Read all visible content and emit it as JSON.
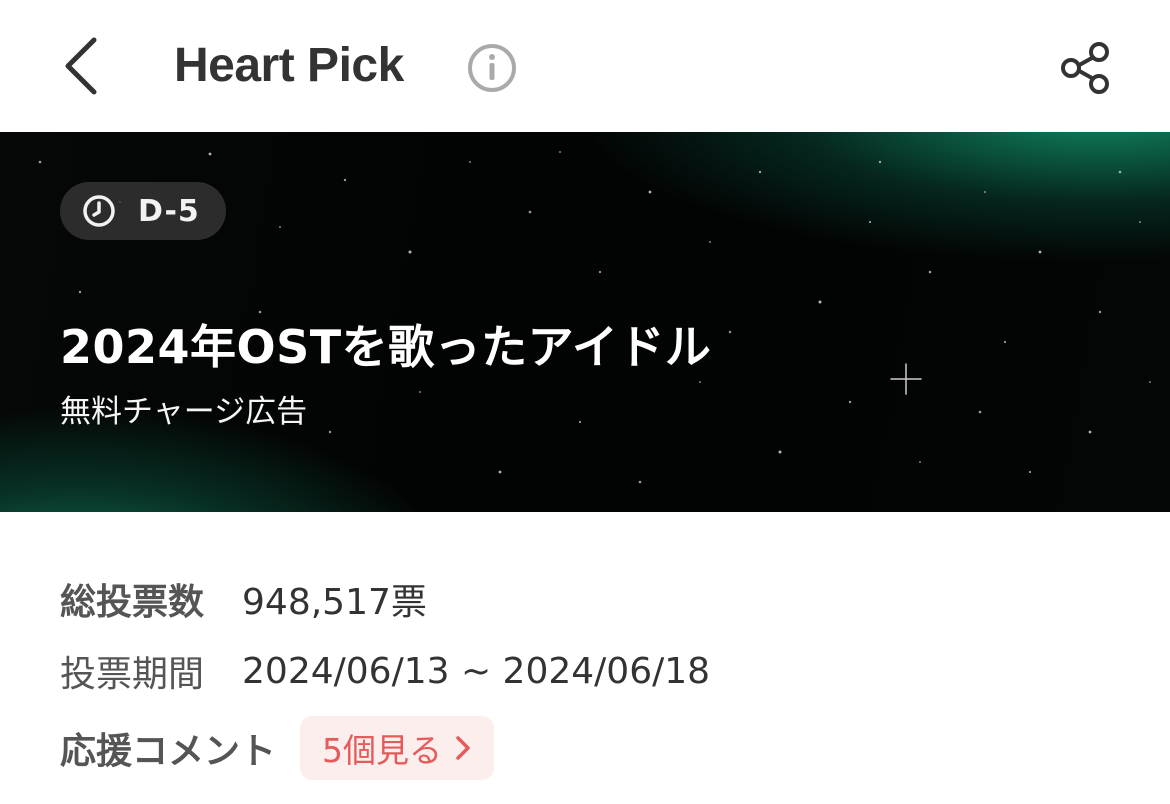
{
  "header": {
    "title": "Heart Pick",
    "back_icon": "chevron-left-icon",
    "info_icon": "info-circle-icon",
    "share_icon": "share-icon"
  },
  "banner": {
    "countdown": "D-5",
    "clock_icon": "clock-icon",
    "title": "2024年OSTを歌ったアイドル",
    "subtitle": "無料チャージ広告"
  },
  "stats": {
    "total_votes_label": "総投票数",
    "total_votes_value": "948,517票",
    "period_label": "投票期間",
    "period_value": "2024/06/13 ~ 2024/06/18",
    "comments_label": "応援コメント",
    "comments_button": "5個見る"
  },
  "colors": {
    "accent_red": "#e55b5b",
    "button_bg": "#fdeeee",
    "banner_green": "#168c64"
  }
}
